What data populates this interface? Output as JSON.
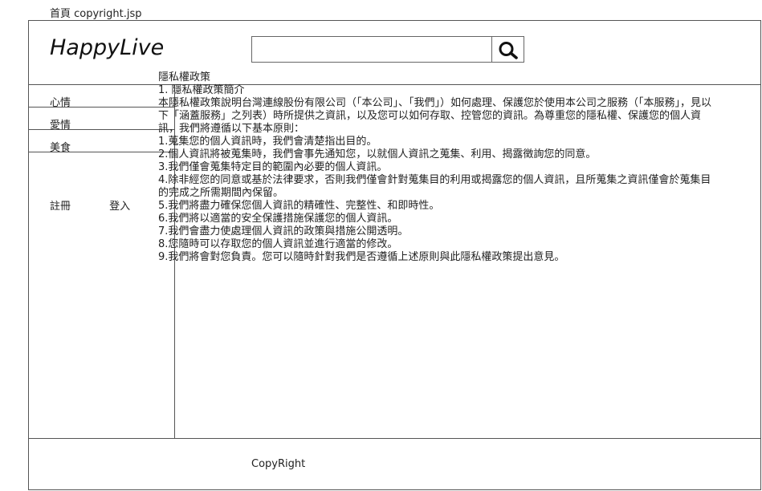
{
  "breadcrumb": "首頁 copyright.jsp",
  "header": {
    "logo": "HappyLive",
    "search": {
      "value": "",
      "placeholder": "",
      "button_icon": "search-icon"
    }
  },
  "sidebar": {
    "items": [
      {
        "label": "心情"
      },
      {
        "label": "愛情"
      },
      {
        "label": "美食"
      }
    ],
    "register_label": "註冊",
    "login_label": "登入"
  },
  "content": {
    "title": "隱私權政策",
    "section_heading": "1.  隱私權政策簡介",
    "intro": "本隱私權政策說明台灣連線股份有限公司（「本公司」、「我們」）如何處理、保護您於使用本公司之服務（「本服務」，見以下「涵蓋服務」之列表）時所提供之資訊，以及您可以如何存取、控管您的資訊。為尊重您的隱私權、保護您的個人資訊，我們將遵循以下基本原則：",
    "principles": [
      "1.蒐集您的個人資訊時，我們會清楚指出目的。",
      "2.個人資訊將被蒐集時，我們會事先通知您，以就個人資訊之蒐集、利用、揭露徵詢您的同意。",
      "3.我們僅會蒐集特定目的範圍內必要的個人資訊。",
      "4.除非經您的同意或基於法律要求，否則我們僅會針對蒐集目的利用或揭露您的個人資訊，且所蒐集之資訊僅會於蒐集目的完成之所需期間內保留。",
      "5.我們將盡力確保您個人資訊的精確性、完整性、和即時性。",
      "6.我們將以適當的安全保護措施保護您的個人資訊。",
      "7.我們會盡力使處理個人資訊的政策與措施公開透明。",
      "8.您隨時可以存取您的個人資訊並進行適當的修改。",
      "9.我們將會對您負責。您可以隨時針對我們是否遵循上述原則與此隱私權政策提出意見。"
    ]
  },
  "footer": {
    "text": "CopyRight"
  }
}
